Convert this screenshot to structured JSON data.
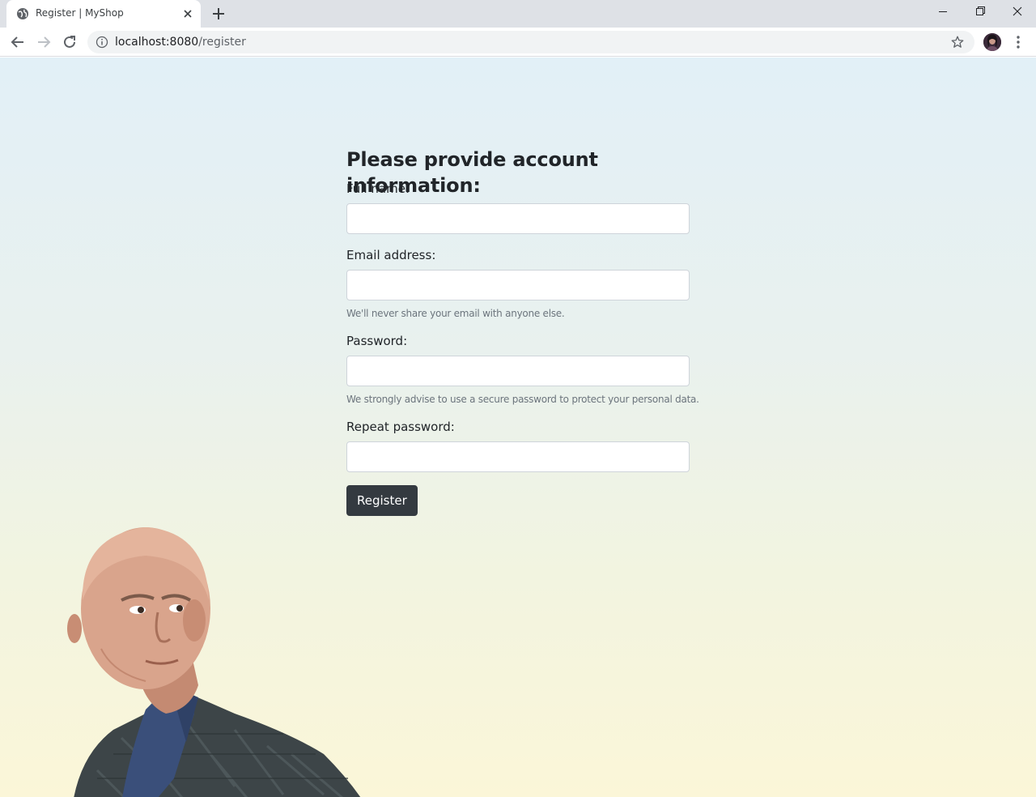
{
  "browser": {
    "tab_title": "Register | MyShop",
    "url_host": "localhost:8080",
    "url_path": "/register"
  },
  "form": {
    "title": "Please provide account information:",
    "full_name_label": "Full name:",
    "email_label": "Email address:",
    "email_help": "We'll never share your email with anyone else.",
    "password_label": "Password:",
    "password_help": "We strongly advise to use a secure password to protect your personal data.",
    "repeat_password_label": "Repeat password:",
    "register_button": "Register",
    "full_name_value": "",
    "email_value": "",
    "password_value": "",
    "repeat_password_value": ""
  },
  "colors": {
    "button_dark": "#343a40",
    "help_text": "#6c757d",
    "input_border": "#ced4da"
  },
  "icons": [
    "globe-icon",
    "close-icon",
    "plus-icon",
    "minimize-icon",
    "restore-icon",
    "window-close-icon",
    "back-icon",
    "forward-icon",
    "reload-icon",
    "info-icon",
    "star-icon",
    "kebab-menu-icon"
  ]
}
